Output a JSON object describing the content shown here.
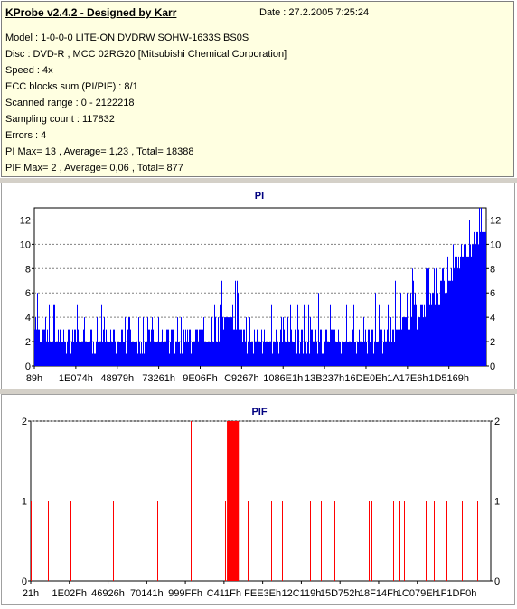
{
  "header": {
    "title": "KProbe v2.4.2 - Designed by Karr",
    "date_label": "Date :",
    "date_value": "27.2.2005 7:25:24",
    "lines": [
      "Model : 1-0-0-0 LITE-ON DVDRW SOHW-1633S BS0S",
      "Disc : DVD-R , MCC 02RG20   [Mitsubishi Chemical Corporation]",
      "Speed : 4x",
      "ECC blocks sum (PI/PIF) : 8/1",
      "Scanned range : 0 - 2122218",
      "Sampling count : 117832",
      "Errors : 4",
      "PI Max= 13 , Average= 1,23 , Total= 18388",
      "PIF Max= 2 , Average= 0,06 , Total= 877"
    ]
  },
  "colors": {
    "pi_fill": "#0000ff",
    "pif_bar": "#ff0000",
    "title_blue": "#000080",
    "grid_dash": "#808080"
  },
  "chart_data": [
    {
      "type": "bar",
      "title": "PI",
      "ylim": [
        0,
        13
      ],
      "yticks": [
        0,
        2,
        4,
        6,
        8,
        10,
        12
      ],
      "xlim": [
        0,
        2122218
      ],
      "xtick_labels": [
        "89h",
        "1E074h",
        "48979h",
        "73261h",
        "9E06Fh",
        "C9267h",
        "1086E1h",
        "13B237h",
        "16DE0Eh",
        "1A17E6h",
        "1D5169h"
      ],
      "grid": "dashed horizontal",
      "profile": {
        "x": [
          0,
          150000,
          300000,
          450000,
          600000,
          750000,
          850000,
          900000,
          950000,
          1000000,
          1200000,
          1500000,
          1650000,
          1700000,
          1800000,
          1900000,
          1950000,
          2000000,
          2050000,
          2122218
        ],
        "typical": [
          3,
          2,
          2,
          2,
          2,
          2,
          2,
          4,
          3,
          2,
          2,
          2,
          2,
          3,
          4,
          6,
          7,
          9,
          10,
          11
        ],
        "max": [
          6,
          5,
          5,
          5,
          5,
          6,
          6,
          9,
          7,
          6,
          6,
          6,
          6,
          7,
          8,
          9,
          10,
          12,
          13,
          13
        ]
      }
    },
    {
      "type": "bar",
      "title": "PIF",
      "ylim": [
        0,
        2
      ],
      "yticks": [
        0,
        1,
        2
      ],
      "xlim": [
        0,
        2122218
      ],
      "xtick_labels": [
        "21h",
        "1E02Fh",
        "46926h",
        "70141h",
        "999FFh",
        "C411Fh",
        "FEE3Eh",
        "12C119h",
        "15D752h",
        "18F14Fh",
        "1C079Eh",
        "1F1DF0h"
      ],
      "grid": "dashed horizontal",
      "spikes": [
        {
          "x": 2000,
          "y": 1
        },
        {
          "x": 80000,
          "y": 1
        },
        {
          "x": 185000,
          "y": 1
        },
        {
          "x": 380000,
          "y": 1
        },
        {
          "x": 585000,
          "y": 1
        },
        {
          "x": 740000,
          "y": 2
        },
        {
          "x": 895000,
          "y": 1
        },
        {
          "x": 1000000,
          "y": 1
        },
        {
          "x": 1110000,
          "y": 1
        },
        {
          "x": 1160000,
          "y": 1
        },
        {
          "x": 1220000,
          "y": 1
        },
        {
          "x": 1290000,
          "y": 1
        },
        {
          "x": 1340000,
          "y": 1
        },
        {
          "x": 1400000,
          "y": 1
        },
        {
          "x": 1440000,
          "y": 1
        },
        {
          "x": 1560000,
          "y": 1
        },
        {
          "x": 1570000,
          "y": 1
        },
        {
          "x": 1670000,
          "y": 1
        },
        {
          "x": 1700000,
          "y": 1
        },
        {
          "x": 1720000,
          "y": 1
        },
        {
          "x": 1820000,
          "y": 1
        },
        {
          "x": 1860000,
          "y": 1
        },
        {
          "x": 1920000,
          "y": 1
        },
        {
          "x": 1960000,
          "y": 1
        },
        {
          "x": 1990000,
          "y": 1
        },
        {
          "x": 2060000,
          "y": 1
        }
      ],
      "block": {
        "x_start": 905000,
        "x_end": 960000,
        "y": 2
      }
    }
  ]
}
